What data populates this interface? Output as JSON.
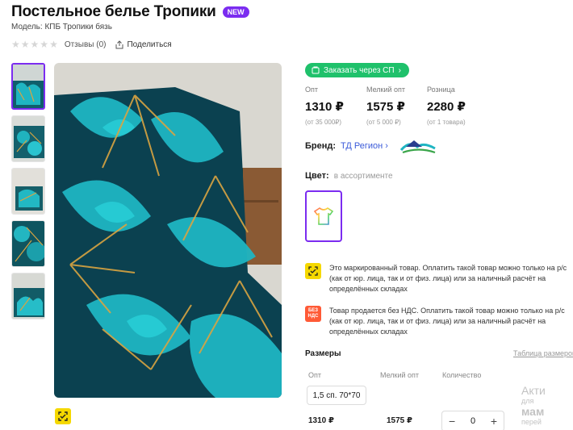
{
  "product": {
    "title": "Постельное белье Тропики",
    "badge": "NEW",
    "model": "Модель: КПБ Тропики бязь"
  },
  "meta": {
    "reviews": "Отзывы (0)",
    "share": "Поделиться",
    "rating": 0
  },
  "order": {
    "label": "Заказать через СП"
  },
  "prices": [
    {
      "label": "Опт",
      "value": "1310 ₽",
      "note": "(от 35 000₽)"
    },
    {
      "label": "Мелкий опт",
      "value": "1575 ₽",
      "note": "(от 5 000 ₽)"
    },
    {
      "label": "Розница",
      "value": "2280 ₽",
      "note": "(от 1 товара)"
    }
  ],
  "brand": {
    "label": "Бренд:",
    "name": "ТД Регион"
  },
  "color": {
    "label": "Цвет:",
    "value": "в ассортименте"
  },
  "notices": [
    {
      "icon": "marking-icon",
      "text": "Это маркированный товар. Оплатить такой товар можно только на р/с (как от юр. лица, так и от физ. лица) или за наличный расчёт на определённых складах"
    },
    {
      "icon": "no-vat-icon",
      "icon_text": "БЕЗ НДС",
      "text": "Товар продается без НДС. Оплатить такой товар можно только на р/с (как от юр. лица, так и от физ. лица) или за наличный расчёт на определённых складах"
    }
  ],
  "sizes": {
    "title": "Размеры",
    "table_link": "Таблица размеров",
    "columns": [
      "Опт",
      "Мелкий опт",
      "Количество"
    ],
    "rows": [
      {
        "size": "1,5 сп. 70*70",
        "opt": "1310 ₽",
        "small_opt": "1575 ₽",
        "qty": "0"
      }
    ]
  },
  "watermark": {
    "line1": "Акти",
    "line2": "для",
    "line3": "мам",
    "line4": "перей"
  },
  "colors": {
    "accent": "#7b2cf0",
    "green": "#1fc16b",
    "link": "#3a5ad9",
    "teal": "#1fb5c2"
  }
}
